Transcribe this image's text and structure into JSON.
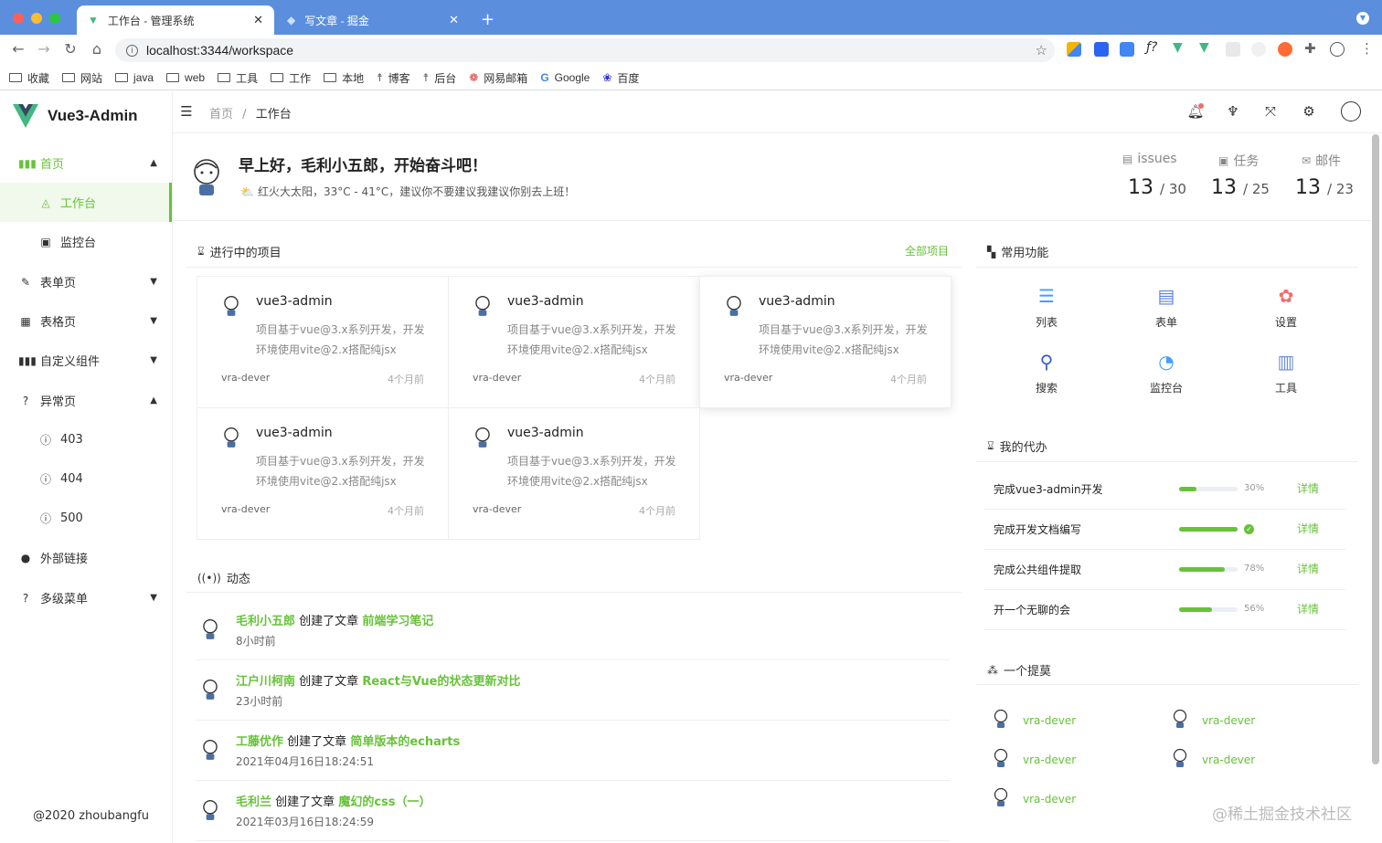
{
  "browser": {
    "tabs": [
      {
        "title": "工作台 - 管理系统",
        "active": true
      },
      {
        "title": "写文章 - 掘金",
        "active": false
      }
    ],
    "new_tab": "+",
    "url": "localhost:3344/workspace",
    "bookmarks": [
      "收藏",
      "网站",
      "java",
      "web",
      "工具",
      "工作",
      "本地",
      "博客",
      "后台",
      "网易邮箱",
      "Google",
      "百度"
    ]
  },
  "sidebar": {
    "logo_text": "Vue3-Admin",
    "items": [
      {
        "label": "首页"
      },
      {
        "label": "工作台"
      },
      {
        "label": "监控台"
      },
      {
        "label": "表单页"
      },
      {
        "label": "表格页"
      },
      {
        "label": "自定义组件"
      },
      {
        "label": "异常页"
      },
      {
        "label": "403"
      },
      {
        "label": "404"
      },
      {
        "label": "500"
      },
      {
        "label": "外部链接"
      },
      {
        "label": "多级菜单"
      }
    ],
    "copyright": "@2020 zhoubangfu"
  },
  "header": {
    "crumb_home": "首页",
    "crumb_sep": "/",
    "crumb_current": "工作台"
  },
  "welcome": {
    "greeting": "早上好，毛利小五郎，开始奋斗吧！",
    "weather": "红火大太阳，33°C - 41°C，建议你不要建议我建议你别去上班！",
    "stats": [
      {
        "label": "issues",
        "done": "13",
        "total": "/ 30"
      },
      {
        "label": "任务",
        "done": "13",
        "total": "/ 25"
      },
      {
        "label": "邮件",
        "done": "13",
        "total": "/ 23"
      }
    ]
  },
  "projects": {
    "title": "进行中的项目",
    "all_link": "全部项目",
    "items": [
      {
        "name": "vue3-admin",
        "desc": "项目基于vue@3.x系列开发，开发环境使用vite@2.x搭配纯jsx",
        "user": "vra-dever",
        "time": "4个月前"
      },
      {
        "name": "vue3-admin",
        "desc": "项目基于vue@3.x系列开发，开发环境使用vite@2.x搭配纯jsx",
        "user": "vra-dever",
        "time": "4个月前"
      },
      {
        "name": "vue3-admin",
        "desc": "项目基于vue@3.x系列开发，开发环境使用vite@2.x搭配纯jsx",
        "user": "vra-dever",
        "time": "4个月前"
      },
      {
        "name": "vue3-admin",
        "desc": "项目基于vue@3.x系列开发，开发环境使用vite@2.x搭配纯jsx",
        "user": "vra-dever",
        "time": "4个月前"
      },
      {
        "name": "vue3-admin",
        "desc": "项目基于vue@3.x系列开发，开发环境使用vite@2.x搭配纯jsx",
        "user": "vra-dever",
        "time": "4个月前"
      }
    ]
  },
  "activity": {
    "title": "动态",
    "verb": "创建了文章",
    "items": [
      {
        "user": "毛利小五郎",
        "article": "前端学习笔记",
        "time": "8小时前"
      },
      {
        "user": "江户川柯南",
        "article": "React与Vue的状态更新对比",
        "time": "23小时前"
      },
      {
        "user": "工藤优作",
        "article": "简单版本的echarts",
        "time": "2021年04月16日18:24:51"
      },
      {
        "user": "毛利兰",
        "article": "魔幻的css（一）",
        "time": "2021年03月16日18:24:59"
      }
    ]
  },
  "quick": {
    "title": "常用功能",
    "items": [
      {
        "label": "列表",
        "icon": "list-icon"
      },
      {
        "label": "表单",
        "icon": "clipboard-icon"
      },
      {
        "label": "设置",
        "icon": "gear-icon"
      },
      {
        "label": "搜索",
        "icon": "search-icon"
      },
      {
        "label": "监控台",
        "icon": "gauge-icon"
      },
      {
        "label": "工具",
        "icon": "tools-icon"
      }
    ]
  },
  "todo": {
    "title": "我的代办",
    "detail_label": "详情",
    "items": [
      {
        "name": "完成vue3-admin开发",
        "progress": 30,
        "pct": "30%"
      },
      {
        "name": "完成开发文档编写",
        "progress": 100,
        "pct": ""
      },
      {
        "name": "完成公共组件提取",
        "progress": 78,
        "pct": "78%"
      },
      {
        "name": "开一个无聊的会",
        "progress": 56,
        "pct": "56%"
      }
    ]
  },
  "team": {
    "title": "一个提莫",
    "members": [
      "vra-dever",
      "vra-dever",
      "vra-dever",
      "vra-dever",
      "vra-dever"
    ]
  },
  "watermark": "@稀土掘金技术社区",
  "colors": {
    "accent": "#67c23a",
    "tabbar": "#5b8fde"
  }
}
